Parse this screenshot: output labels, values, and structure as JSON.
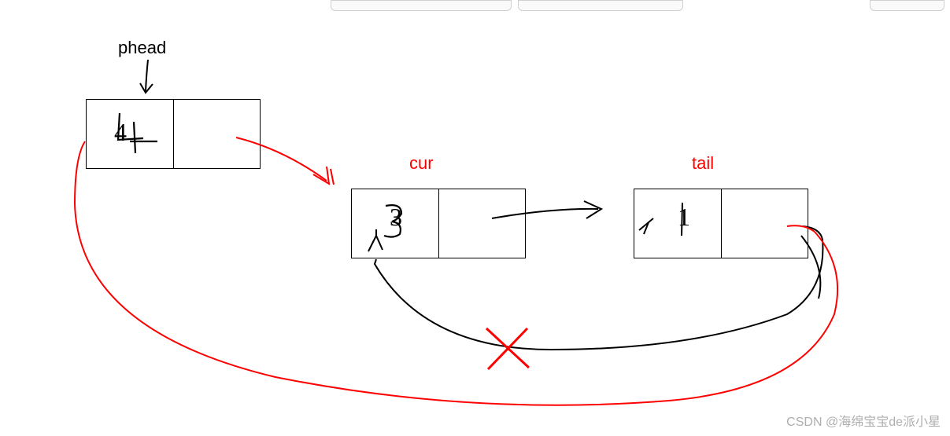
{
  "labels": {
    "phead": "phead",
    "cur": "cur",
    "tail": "tail"
  },
  "nodes": {
    "phead_value": "4",
    "cur_value": "3",
    "tail_value": "1"
  },
  "watermark": "CSDN @海绵宝宝de派小星"
}
